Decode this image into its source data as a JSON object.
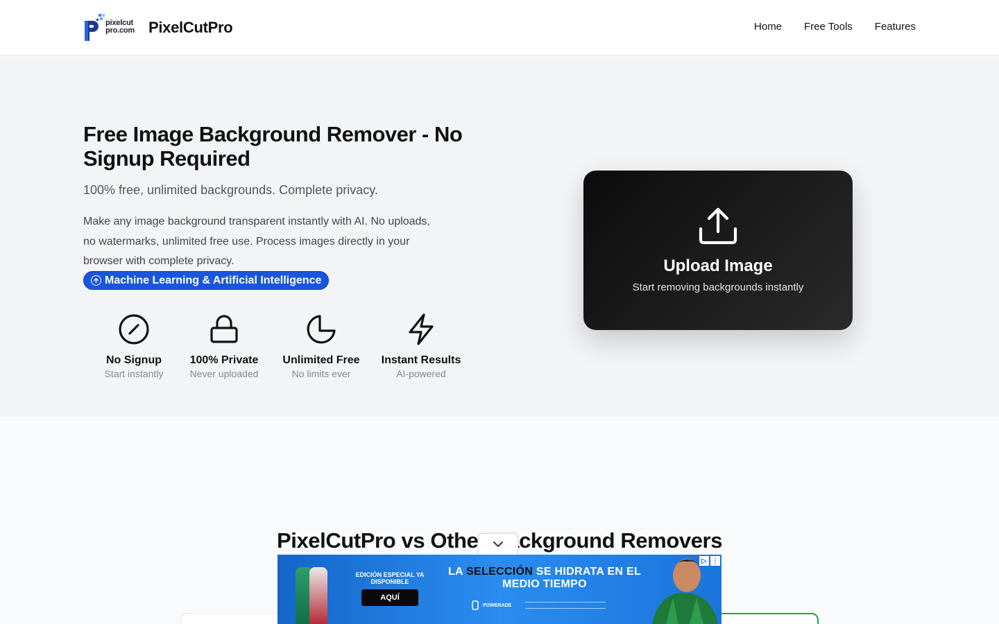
{
  "header": {
    "logo_small_line1": "pixelcut",
    "logo_small_line2": "pro.com",
    "brand": "PixelCutPro",
    "nav": [
      "Home",
      "Free Tools",
      "Features"
    ]
  },
  "hero": {
    "title": "Free Image Background Remover - No Signup Required",
    "subtitle": "100% free, unlimited backgrounds. Complete privacy.",
    "description": "Make any image background transparent instantly with AI. No uploads, no watermarks, unlimited free use. Process images directly in your browser with complete privacy.",
    "badge": "Machine Learning & Artificial Intelligence",
    "features": [
      {
        "icon": "compass-icon",
        "title": "No Signup",
        "sub": "Start instantly"
      },
      {
        "icon": "lock-icon",
        "title": "100% Private",
        "sub": "Never uploaded"
      },
      {
        "icon": "pie-chart-icon",
        "title": "Unlimited Free",
        "sub": "No limits ever"
      },
      {
        "icon": "lightning-icon",
        "title": "Instant Results",
        "sub": "AI-powered"
      }
    ]
  },
  "upload": {
    "icon": "upload-icon",
    "title": "Upload Image",
    "subtitle": "Start removing backgrounds instantly"
  },
  "comparison": {
    "title": "PixelCutPro vs Other Background Removers"
  },
  "ad": {
    "left_text": "EDICIÓN ESPECIAL YA DISPONIBLE",
    "button": "AQUÍ",
    "headline_pre": "LA ",
    "headline_highlight": "SELECCIÓN",
    "headline_post": " SE HIDRATA EN EL MEDIO TIEMPO",
    "brand": "POWERADE"
  },
  "colors": {
    "accent_blue": "#1a56db",
    "upload_card": "#111111",
    "hero_bg": "#f3f4f6",
    "ad_blue": "#1d7fe0",
    "green_border": "#22a34a"
  }
}
